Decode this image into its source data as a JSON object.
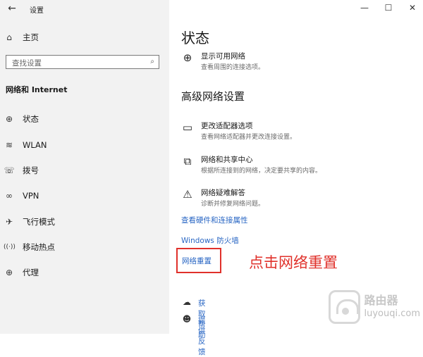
{
  "window": {
    "title": "设置",
    "back_icon": "←",
    "minimize_icon": "—",
    "maximize_icon": "☐",
    "close_icon": "✕"
  },
  "sidebar": {
    "home_label": "主页",
    "home_icon": "⌂",
    "search_placeholder": "查找设置",
    "search_icon": "⌕",
    "section_title": "网络和 Internet",
    "items": [
      {
        "label": "状态",
        "icon": "⊕",
        "icon_name": "globe-icon"
      },
      {
        "label": "WLAN",
        "icon": "≋",
        "icon_name": "wifi-icon"
      },
      {
        "label": "拨号",
        "icon": "☏",
        "icon_name": "phone-icon"
      },
      {
        "label": "VPN",
        "icon": "∞",
        "icon_name": "vpn-icon"
      },
      {
        "label": "飞行模式",
        "icon": "✈",
        "icon_name": "airplane-icon"
      },
      {
        "label": "移动热点",
        "icon": "((·))",
        "icon_name": "hotspot-icon"
      },
      {
        "label": "代理",
        "icon": "⊕",
        "icon_name": "proxy-globe-icon"
      }
    ]
  },
  "main": {
    "status_heading": "状态",
    "show_networks": {
      "title": "显示可用网络",
      "desc": "查看周围的连接选项。",
      "icon": "⊕"
    },
    "advanced_heading": "高级网络设置",
    "advanced_items": [
      {
        "title": "更改适配器选项",
        "desc": "查看网络适配器并更改连接设置。",
        "icon": "▭",
        "icon_name": "adapter-monitor-icon"
      },
      {
        "title": "网络和共享中心",
        "desc": "根据所连接到的网络，决定要共享的内容。",
        "icon": "⧉",
        "icon_name": "sharing-center-icon"
      },
      {
        "title": "网络疑难解答",
        "desc": "诊断并修复网络问题。",
        "icon": "⚠",
        "icon_name": "warning-icon"
      }
    ],
    "link_hardware": "查看硬件和连接属性",
    "link_firewall": "Windows 防火墙",
    "link_reset": "网络重置",
    "annotation": "点击网络重置",
    "help_label": "获取帮助",
    "help_icon": "☁",
    "feedback_label": "提供反馈",
    "feedback_icon": "☻"
  },
  "watermark": {
    "name": "路由器",
    "domain": "luyouqi.com"
  },
  "colors": {
    "link": "#2a67c4",
    "annotation_red": "#e0312b",
    "sidebar_bg": "#f2f2f2"
  }
}
